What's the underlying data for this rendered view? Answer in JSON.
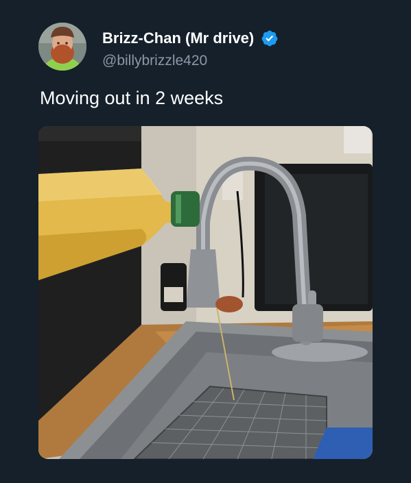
{
  "tweet": {
    "display_name": "Brizz-Chan (Mr drive)",
    "handle": "@billybrizzle420",
    "verified": true,
    "text": "Moving out in 2 weeks"
  },
  "media": {
    "type": "photo"
  },
  "colors": {
    "background": "#15202b",
    "primary_text": "#ffffff",
    "secondary_text": "#8b98a5",
    "verified_badge": "#1d9bf0"
  },
  "icons": {
    "verified": "verified-badge-icon"
  }
}
